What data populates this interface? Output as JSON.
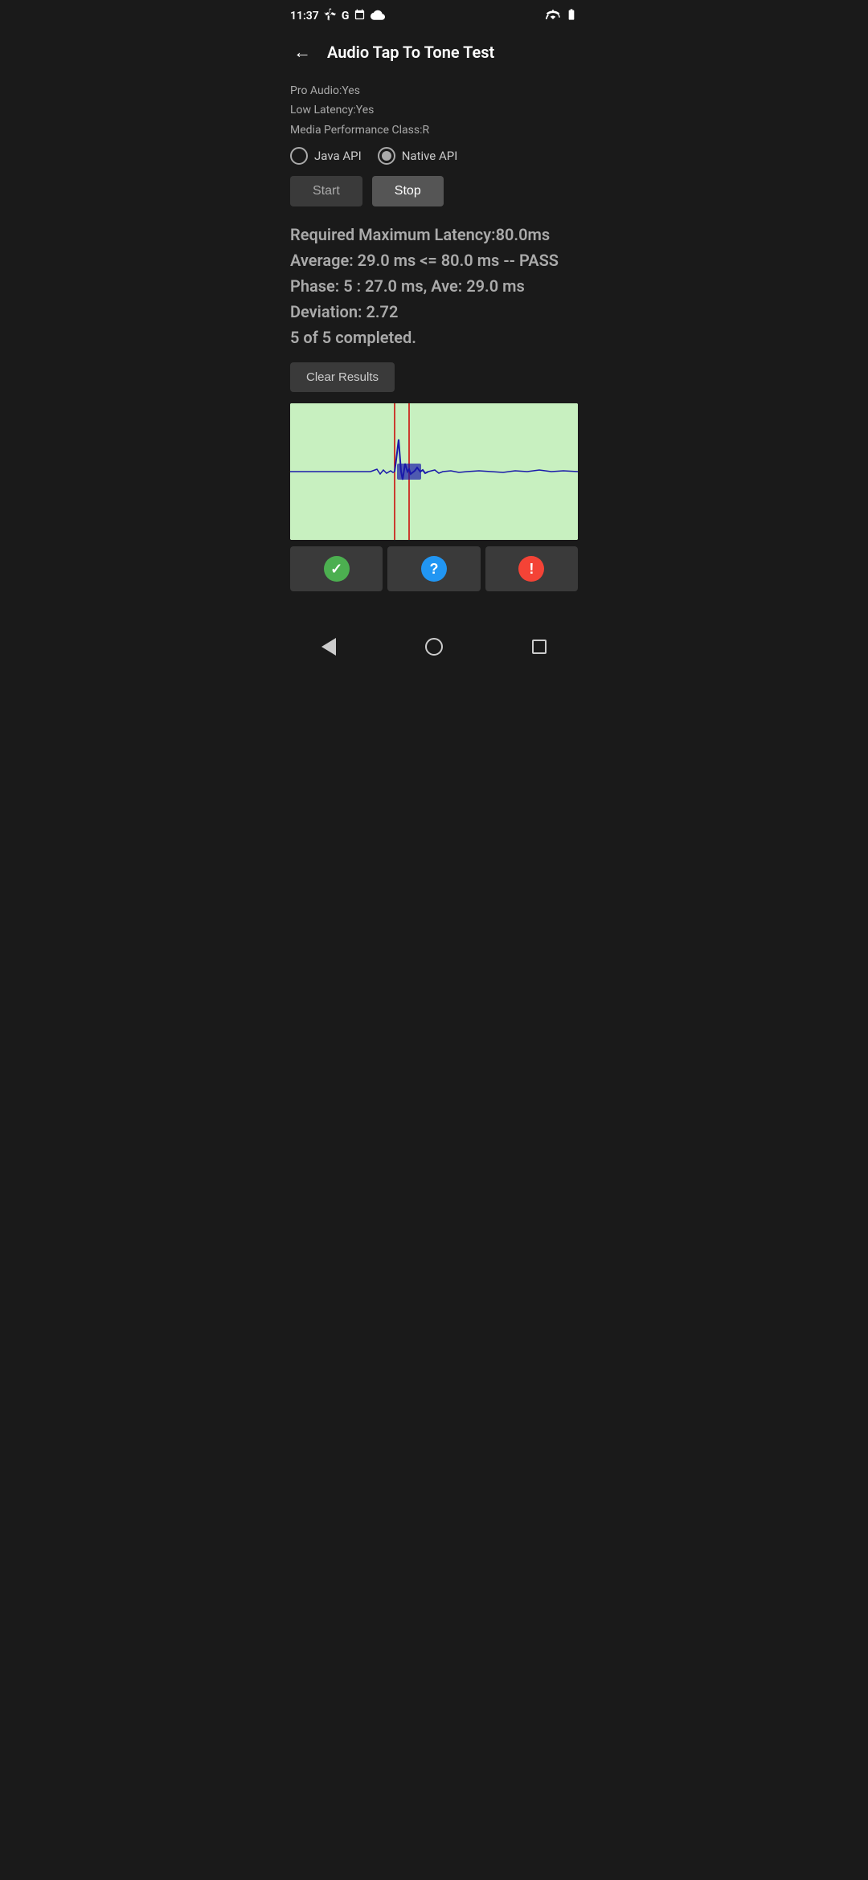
{
  "statusBar": {
    "time": "11:37",
    "icons": [
      "fan",
      "G",
      "calendar",
      "cloud"
    ],
    "rightIcons": [
      "wifi",
      "battery"
    ]
  },
  "appBar": {
    "title": "Audio Tap To Tone Test",
    "backLabel": "←"
  },
  "deviceInfo": {
    "proAudio": "Pro Audio:Yes",
    "lowLatency": "Low Latency:Yes",
    "mediaPerformance": "Media Performance Class:R"
  },
  "radioGroup": {
    "option1": {
      "label": "Java API",
      "selected": false
    },
    "option2": {
      "label": "Native API",
      "selected": true
    }
  },
  "buttons": {
    "startLabel": "Start",
    "stopLabel": "Stop",
    "clearResultsLabel": "Clear Results"
  },
  "results": {
    "line1": "Required Maximum Latency:80.0ms",
    "line2": "Average: 29.0 ms <= 80.0 ms -- PASS",
    "line3": "Phase: 5 : 27.0 ms, Ave: 29.0 ms",
    "line4": "Deviation: 2.72",
    "line5": "5 of 5 completed."
  },
  "actionButtons": {
    "checkIcon": "✓",
    "questionIcon": "?",
    "exclamationIcon": "!"
  },
  "navBar": {
    "back": "back",
    "home": "home",
    "recent": "recent"
  }
}
